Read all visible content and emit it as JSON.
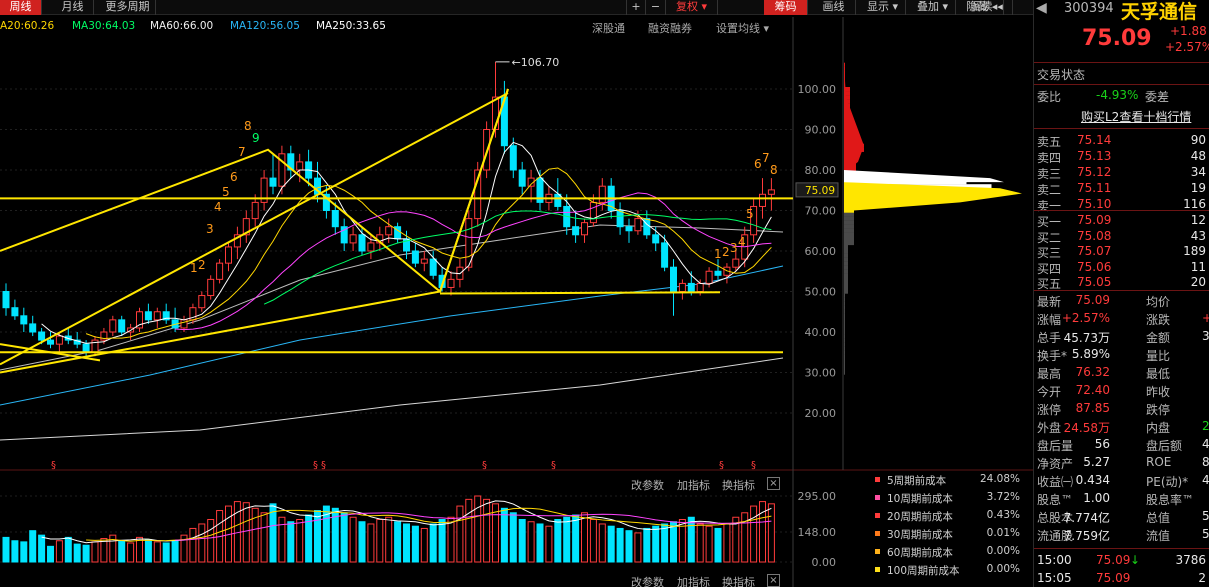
{
  "toolbar": {
    "tabs": [
      {
        "label": "周线",
        "active": true
      },
      {
        "label": "月线",
        "active": false
      },
      {
        "label": "更多周期",
        "active": false
      }
    ],
    "right_buttons": [
      {
        "label": "+",
        "name": "zoom-in-button"
      },
      {
        "label": "−",
        "name": "zoom-out-button"
      },
      {
        "label": "复权 ▾",
        "name": "fuquan-dropdown"
      },
      {
        "label": "筹码",
        "name": "chips-button"
      },
      {
        "label": "画线",
        "name": "draw-line-button"
      },
      {
        "label": "显示 ▾",
        "name": "display-dropdown"
      },
      {
        "label": "叠加 ▾",
        "name": "overlay-dropdown"
      },
      {
        "label": "阅读",
        "name": "read-button"
      },
      {
        "label": "隐藏 ◂◂",
        "name": "hide-button"
      }
    ]
  },
  "ma_legend": [
    {
      "label": "A20:60.26",
      "color": "#ffd700"
    },
    {
      "label": "MA30:64.03",
      "color": "#00ff66"
    },
    {
      "label": "MA60:66.00",
      "color": "#f0f0f0"
    },
    {
      "label": "MA120:56.05",
      "color": "#29b6f6"
    },
    {
      "label": "MA250:33.65",
      "color": "#ffffff"
    }
  ],
  "chart_links": [
    "深股通",
    "融资融券",
    "设置均线 ▾"
  ],
  "chart_data": {
    "type": "candlestick",
    "period": "weekly",
    "y_ticks": [
      100.0,
      90.0,
      80.0,
      70.0,
      60.0,
      50.0,
      40.0,
      30.0,
      20.0
    ],
    "price_label": "75.09",
    "peak_label": "106.70",
    "volume_ticks": [
      "295.00",
      "148.00",
      "0.00"
    ],
    "countdown_labels": [
      "1",
      "2",
      "3",
      "4",
      "5",
      "6",
      "7",
      "8",
      "9"
    ],
    "candles": [
      [
        50,
        52,
        44,
        46
      ],
      [
        46,
        48,
        43,
        44
      ],
      [
        44,
        46,
        40,
        42
      ],
      [
        42,
        44,
        39,
        40
      ],
      [
        40,
        41,
        37,
        38
      ],
      [
        38,
        40,
        36,
        37
      ],
      [
        37,
        40,
        35,
        39
      ],
      [
        39,
        41,
        37,
        38
      ],
      [
        38,
        40,
        36,
        37
      ],
      [
        37,
        38,
        34,
        35
      ],
      [
        35,
        39,
        34,
        38
      ],
      [
        38,
        41,
        37,
        40
      ],
      [
        40,
        44,
        39,
        43
      ],
      [
        43,
        44,
        39,
        40
      ],
      [
        40,
        42,
        38,
        41
      ],
      [
        41,
        46,
        40,
        45
      ],
      [
        45,
        47,
        42,
        43
      ],
      [
        43,
        46,
        41,
        45
      ],
      [
        45,
        47,
        42,
        43
      ],
      [
        43,
        46,
        40,
        41
      ],
      [
        41,
        44,
        40,
        43
      ],
      [
        43,
        47,
        42,
        46
      ],
      [
        46,
        50,
        45,
        49
      ],
      [
        49,
        54,
        48,
        53
      ],
      [
        53,
        58,
        52,
        57
      ],
      [
        57,
        62,
        55,
        61
      ],
      [
        61,
        66,
        58,
        64
      ],
      [
        64,
        70,
        62,
        68
      ],
      [
        68,
        74,
        66,
        72
      ],
      [
        72,
        80,
        70,
        78
      ],
      [
        78,
        84,
        74,
        76
      ],
      [
        76,
        86,
        74,
        84
      ],
      [
        84,
        86,
        78,
        80
      ],
      [
        80,
        84,
        77,
        82
      ],
      [
        82,
        85,
        76,
        78
      ],
      [
        78,
        82,
        72,
        74
      ],
      [
        74,
        76,
        68,
        70
      ],
      [
        70,
        72,
        64,
        66
      ],
      [
        66,
        68,
        60,
        62
      ],
      [
        62,
        66,
        60,
        64
      ],
      [
        64,
        66,
        59,
        60
      ],
      [
        60,
        64,
        58,
        62
      ],
      [
        62,
        66,
        60,
        64
      ],
      [
        64,
        68,
        62,
        66
      ],
      [
        66,
        67,
        62,
        63
      ],
      [
        63,
        65,
        58,
        60
      ],
      [
        60,
        62,
        56,
        57
      ],
      [
        57,
        60,
        55,
        58
      ],
      [
        58,
        60,
        53,
        54
      ],
      [
        54,
        56,
        50,
        51
      ],
      [
        51,
        55,
        49,
        53
      ],
      [
        53,
        58,
        51,
        56
      ],
      [
        56,
        70,
        55,
        68
      ],
      [
        68,
        82,
        66,
        80
      ],
      [
        80,
        92,
        78,
        90
      ],
      [
        90,
        106.7,
        88,
        98
      ],
      [
        98,
        102,
        84,
        86
      ],
      [
        86,
        88,
        78,
        80
      ],
      [
        80,
        82,
        74,
        76
      ],
      [
        76,
        80,
        72,
        78
      ],
      [
        78,
        80,
        70,
        72
      ],
      [
        72,
        76,
        70,
        74
      ],
      [
        74,
        78,
        70,
        71
      ],
      [
        71,
        74,
        64,
        66
      ],
      [
        66,
        70,
        62,
        64
      ],
      [
        64,
        68,
        62,
        67
      ],
      [
        67,
        74,
        66,
        72
      ],
      [
        72,
        78,
        70,
        76
      ],
      [
        76,
        78,
        68,
        70
      ],
      [
        70,
        72,
        64,
        66
      ],
      [
        66,
        68,
        62,
        65
      ],
      [
        65,
        70,
        64,
        68
      ],
      [
        68,
        70,
        63,
        64
      ],
      [
        64,
        66,
        60,
        62
      ],
      [
        62,
        64,
        55,
        56
      ],
      [
        56,
        58,
        44,
        50
      ],
      [
        50,
        53,
        48,
        52
      ],
      [
        52,
        55,
        49,
        50
      ],
      [
        50,
        53,
        49,
        52
      ],
      [
        52,
        56,
        51,
        55
      ],
      [
        55,
        58,
        53,
        54
      ],
      [
        54,
        57,
        52,
        56
      ],
      [
        56,
        60,
        55,
        58
      ],
      [
        58,
        66,
        56,
        64
      ],
      [
        64,
        73,
        62,
        71
      ],
      [
        71,
        78,
        68,
        74
      ],
      [
        74,
        78,
        70,
        75.09
      ]
    ],
    "volumes": [
      110,
      95,
      90,
      140,
      120,
      70,
      95,
      110,
      80,
      75,
      90,
      105,
      120,
      95,
      85,
      110,
      100,
      90,
      85,
      95,
      120,
      150,
      170,
      190,
      230,
      250,
      270,
      265,
      240,
      220,
      260,
      200,
      180,
      190,
      210,
      230,
      250,
      240,
      220,
      200,
      180,
      170,
      190,
      200,
      180,
      170,
      160,
      150,
      170,
      190,
      200,
      250,
      280,
      295,
      280,
      260,
      240,
      220,
      190,
      180,
      170,
      160,
      190,
      200,
      210,
      220,
      190,
      170,
      160,
      150,
      140,
      130,
      150,
      160,
      170,
      180,
      190,
      200,
      170,
      160,
      150,
      170,
      200,
      220,
      250,
      270,
      260
    ],
    "volume_unit_max": 295
  },
  "indicator_bars": [
    {
      "change_params": "改参数",
      "add_indicator": "加指标",
      "swap_indicator": "换指标",
      "close": "×"
    },
    {
      "change_params": "改参数",
      "add_indicator": "加指标",
      "swap_indicator": "换指标",
      "close": "×"
    }
  ],
  "cost_legend": [
    {
      "label": "5周期前成本",
      "value": "24.08%",
      "color": "#ff3b3b"
    },
    {
      "label": "10周期前成本",
      "value": "3.72%",
      "color": "#ff4fa3"
    },
    {
      "label": "20周期前成本",
      "value": "0.43%",
      "color": "#ff3b3b"
    },
    {
      "label": "30周期前成本",
      "value": "0.01%",
      "color": "#ff7a1a"
    },
    {
      "label": "60周期前成本",
      "value": "0.00%",
      "color": "#ffb21a"
    },
    {
      "label": "100周期前成本",
      "value": "0.00%",
      "color": "#ffe01a"
    }
  ],
  "quote": {
    "code": "300394",
    "name": "天孚通信",
    "price": "75.09",
    "change": "+1.88",
    "change_pct": "+2.57%",
    "trade_state": "交易状态",
    "weibi_label": "委比",
    "weibi_value": "-4.93%",
    "weicha_label": "委差",
    "l2_link": "购买L2查看十档行情",
    "asks": [
      {
        "label": "卖五",
        "price": "75.14",
        "vol": "90"
      },
      {
        "label": "卖四",
        "price": "75.13",
        "vol": "48"
      },
      {
        "label": "卖三",
        "price": "75.12",
        "vol": "34"
      },
      {
        "label": "卖二",
        "price": "75.11",
        "vol": "19"
      },
      {
        "label": "卖一",
        "price": "75.10",
        "vol": "116"
      }
    ],
    "bids": [
      {
        "label": "买一",
        "price": "75.09",
        "vol": "12"
      },
      {
        "label": "买二",
        "price": "75.08",
        "vol": "43"
      },
      {
        "label": "买三",
        "price": "75.07",
        "vol": "189"
      },
      {
        "label": "买四",
        "price": "75.06",
        "vol": "11"
      },
      {
        "label": "买五",
        "price": "75.05",
        "vol": "20"
      }
    ],
    "stats": [
      {
        "l1": "最新",
        "v1": "75.09",
        "c1": "red",
        "l2": "均价",
        "v2": "",
        "c2": "white"
      },
      {
        "l1": "涨幅",
        "v1": "+2.57%",
        "c1": "red",
        "l2": "涨跌",
        "v2": "+",
        "c2": "red"
      },
      {
        "l1": "总手",
        "v1": "45.73万",
        "c1": "white",
        "l2": "金额",
        "v2": "33",
        "c2": "white"
      },
      {
        "l1": "换手*",
        "v1": "5.89%",
        "c1": "white",
        "l2": "量比",
        "v2": "",
        "c2": "white"
      },
      {
        "l1": "最高",
        "v1": "76.32",
        "c1": "red",
        "l2": "最低",
        "v2": "",
        "c2": "white"
      },
      {
        "l1": "今开",
        "v1": "72.40",
        "c1": "red",
        "l2": "昨收",
        "v2": "",
        "c2": "white"
      },
      {
        "l1": "涨停",
        "v1": "87.85",
        "c1": "red",
        "l2": "跌停",
        "v2": "",
        "c2": "green"
      },
      {
        "l1": "外盘",
        "v1": "24.58万",
        "c1": "red",
        "l2": "内盘",
        "v2": "21",
        "c2": "green"
      },
      {
        "l1": "盘后量",
        "v1": "56",
        "c1": "white",
        "l2": "盘后额",
        "v2": "4",
        "c2": "white"
      },
      {
        "l1": "净资产",
        "v1": "5.27",
        "c1": "white",
        "l2": "ROE",
        "v2": "8",
        "c2": "white"
      },
      {
        "l1": "收益㈠",
        "v1": "0.434",
        "c1": "white",
        "l2": "PE(动)*",
        "v2": "4",
        "c2": "white"
      },
      {
        "l1": "股息™",
        "v1": "1.00",
        "c1": "white",
        "l2": "股息率™",
        "v2": "",
        "c2": "white"
      },
      {
        "l1": "总股本",
        "v1": "7.774亿",
        "c1": "white",
        "l2": "总值",
        "v2": "58",
        "c2": "white"
      },
      {
        "l1": "流通股",
        "v1": "7.759亿",
        "c1": "white",
        "l2": "流值",
        "v2": "58",
        "c2": "white"
      }
    ],
    "ticks": [
      {
        "time": "15:00",
        "price": "75.09",
        "arrow": "↓",
        "vol": "3786"
      },
      {
        "time": "15:05",
        "price": "75.09",
        "arrow": "",
        "vol": "2"
      }
    ]
  }
}
